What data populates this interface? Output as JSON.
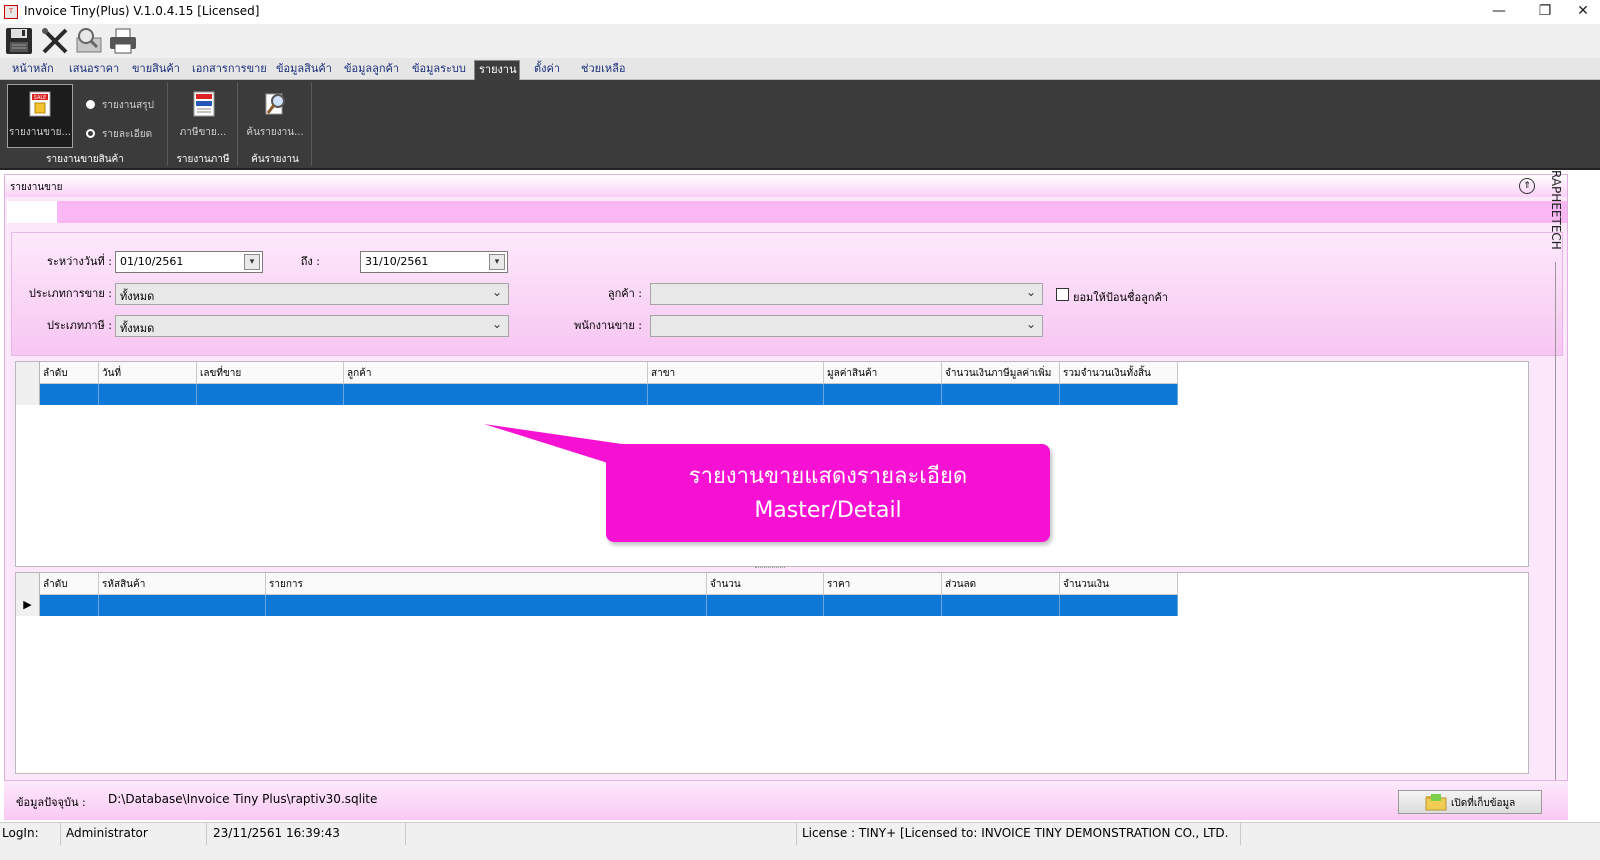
{
  "window": {
    "title": "Invoice Tiny(Plus)  V.1.0.4.15 [Licensed]",
    "app_icon": "invoice-app-icon",
    "minimize": "—",
    "restore": "❐",
    "close": "✕"
  },
  "toolbar": {
    "icons": [
      "save-icon",
      "tools-icon",
      "preview-icon",
      "print-icon"
    ]
  },
  "menu": {
    "tabs": [
      "หน้าหลัก",
      "เสนอราคา",
      "ขายสินค้า",
      "เอกสารการขาย",
      "ข้อมูลสินค้า",
      "ข้อมูลลูกค้า",
      "ข้อมูลระบบ",
      "รายงาน",
      "ตั้งค่า",
      "ช่วยเหลือ"
    ],
    "active": "รายงาน"
  },
  "ribbon": {
    "sales_report_button": "รายงานขาย...",
    "radio_summary": "รายงานสรุป",
    "radio_detail": "รายละเอียด",
    "radio_selected": "รายละเอียด",
    "group_sales": "รายงานขายสินค้า",
    "tax_button": "ภาษีขาย...",
    "group_tax": "รายงานภาษี",
    "search_button": "ค้นรายงาน...",
    "group_search": "ค้นรายงาน"
  },
  "panel": {
    "title": "รายงานขาย",
    "collapse_icon": "collapse-up-icon",
    "side_label": "RAPHEETECH"
  },
  "filters": {
    "from_label": "ระหว่างวันที่ :",
    "from_value": "01/10/2561",
    "to_label": "ถึง :",
    "to_value": "31/10/2561",
    "sale_type_label": "ประเภทการขาย :",
    "sale_type_value": "ทั้งหมด",
    "tax_type_label": "ประเภทภาษี :",
    "tax_type_value": "ทั้งหมด",
    "customer_label": "ลูกค้า :",
    "customer_value": "",
    "salesperson_label": "พนักงานขาย :",
    "salesperson_value": "",
    "allow_name_label": "ยอมให้ป้อนชื่อลูกค้า",
    "allow_name_checked": false
  },
  "master_grid": {
    "columns": [
      "ลำดับ",
      "วันที่",
      "เลขที่ขาย",
      "ลูกค้า",
      "สาขา",
      "มูลค่าสินค้า",
      "จำนวนเงินภาษีมูลค่าเพิ่ม",
      "รวมจำนวนเงินทั้งสิ้น"
    ]
  },
  "detail_grid": {
    "columns": [
      "ลำดับ",
      "รหัสสินค้า",
      "รายการ",
      "จำนวน",
      "ราคา",
      "ส่วนลด",
      "จำนวนเงิน"
    ],
    "row_indicator": "▶"
  },
  "callout": {
    "line1": "รายงานขายแสดงรายละเอียด",
    "line2": "Master/Detail",
    "color": "#f712d3"
  },
  "footer": {
    "db_label": "ข้อมูลปัจจุบัน :",
    "db_path": "D:\\Database\\Invoice Tiny Plus\\raptiv30.sqlite",
    "open_button": "เปิดที่เก็บข้อมูล",
    "open_icon": "folder-icon"
  },
  "status": {
    "login_label": "LogIn:",
    "user": "Administrator",
    "datetime": "23/11/2561 16:39:43",
    "license": "License : TINY+ [Licensed to: INVOICE TINY DEMONSTRATION CO., LTD."
  }
}
